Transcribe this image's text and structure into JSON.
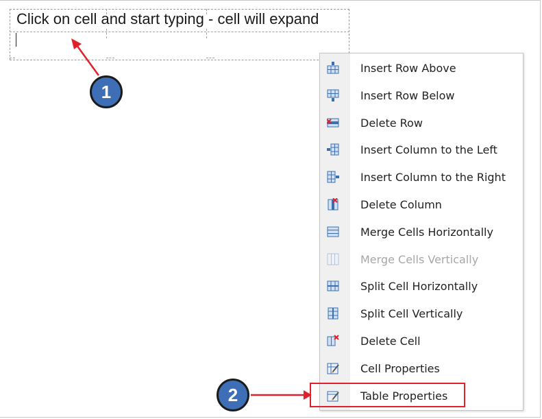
{
  "cell": {
    "text": "Click on cell and start typing - cell will expand"
  },
  "context_menu": {
    "items": [
      {
        "label": "Insert Row Above",
        "icon": "insert-row-above-icon",
        "disabled": false
      },
      {
        "label": "Insert Row Below",
        "icon": "insert-row-below-icon",
        "disabled": false
      },
      {
        "label": "Delete Row",
        "icon": "delete-row-icon",
        "disabled": false
      },
      {
        "label": "Insert Column to the Left",
        "icon": "insert-column-left-icon",
        "disabled": false
      },
      {
        "label": "Insert Column to the Right",
        "icon": "insert-column-right-icon",
        "disabled": false
      },
      {
        "label": "Delete Column",
        "icon": "delete-column-icon",
        "disabled": false
      },
      {
        "label": "Merge Cells Horizontally",
        "icon": "merge-cells-horizontal-icon",
        "disabled": false
      },
      {
        "label": "Merge Cells Vertically",
        "icon": "merge-cells-vertical-icon",
        "disabled": true
      },
      {
        "label": "Split Cell Horizontally",
        "icon": "split-cell-horizontal-icon",
        "disabled": false
      },
      {
        "label": "Split Cell Vertically",
        "icon": "split-cell-vertical-icon",
        "disabled": false
      },
      {
        "label": "Delete Cell",
        "icon": "delete-cell-icon",
        "disabled": false
      },
      {
        "label": "Cell Properties",
        "icon": "cell-properties-icon",
        "disabled": false
      },
      {
        "label": "Table Properties",
        "icon": "table-properties-icon",
        "disabled": false
      }
    ]
  },
  "annotations": {
    "step1": "1",
    "step2": "2",
    "arrow_color": "#e0212b",
    "badge_color": "#3e6fb6"
  }
}
